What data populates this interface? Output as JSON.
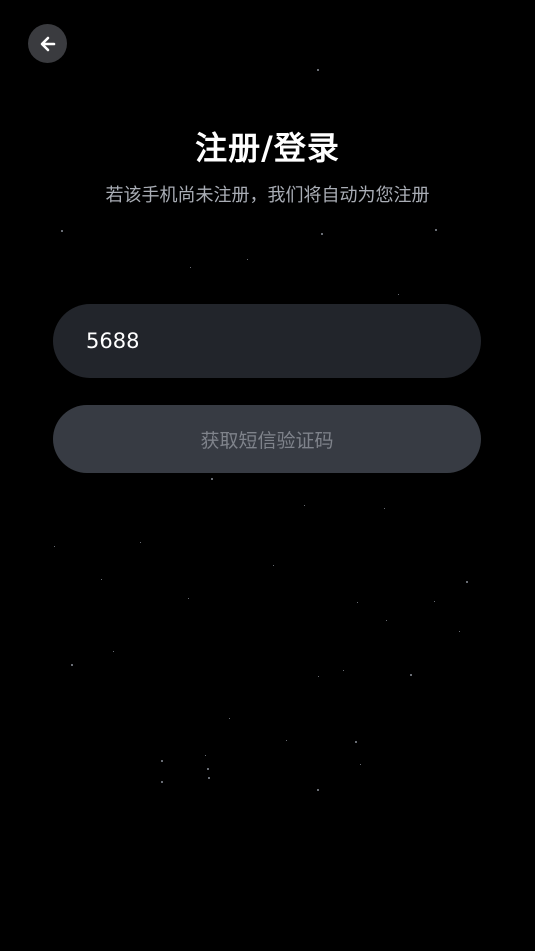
{
  "header": {
    "back_icon": "arrow-left-icon",
    "title": "注册/登录",
    "subtitle": "若该手机尚未注册，我们将自动为您注册"
  },
  "form": {
    "phone_value": "5688",
    "sms_button_label": "获取短信验证码"
  },
  "colors": {
    "background": "#000000",
    "input_bg": "#22252b",
    "button_bg": "#373b43",
    "button_text": "#7f838b",
    "subtitle_text": "#a9adb5"
  }
}
